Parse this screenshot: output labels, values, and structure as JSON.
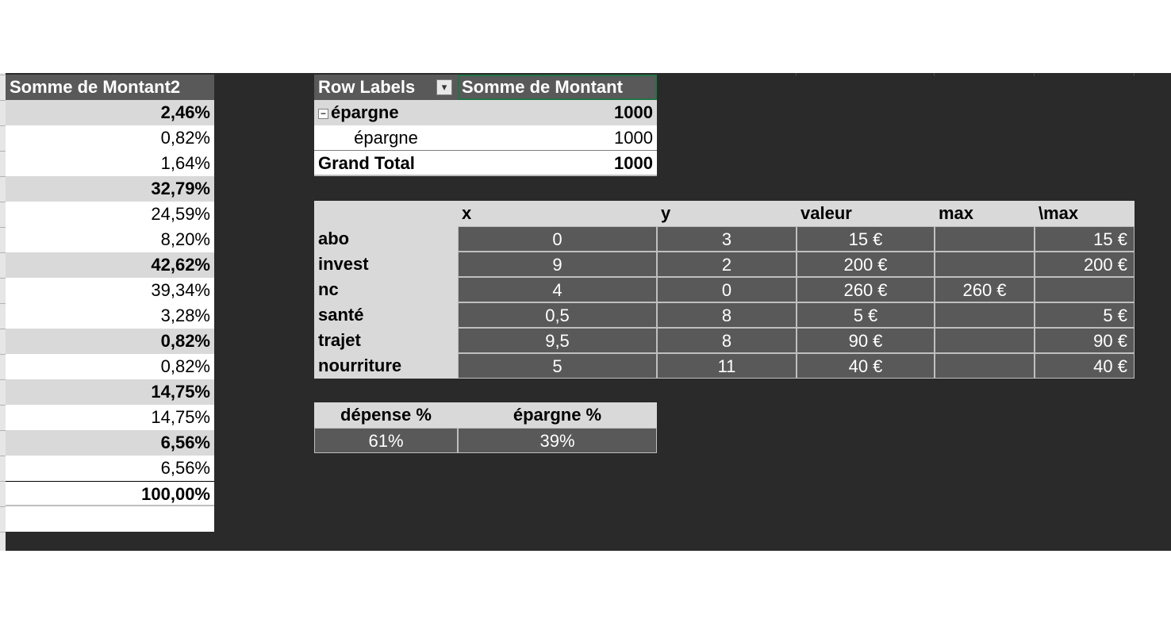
{
  "left_pivot": {
    "header": "Somme de Montant2",
    "rows": [
      {
        "value": "2,46%",
        "bold": true
      },
      {
        "value": "0,82%",
        "bold": false
      },
      {
        "value": "1,64%",
        "bold": false
      },
      {
        "value": "32,79%",
        "bold": true
      },
      {
        "value": "24,59%",
        "bold": false
      },
      {
        "value": "8,20%",
        "bold": false
      },
      {
        "value": "42,62%",
        "bold": true
      },
      {
        "value": "39,34%",
        "bold": false
      },
      {
        "value": "3,28%",
        "bold": false
      },
      {
        "value": "0,82%",
        "bold": true
      },
      {
        "value": "0,82%",
        "bold": false
      },
      {
        "value": "14,75%",
        "bold": true
      },
      {
        "value": "14,75%",
        "bold": false
      },
      {
        "value": "6,56%",
        "bold": true
      },
      {
        "value": "6,56%",
        "bold": false
      }
    ],
    "total": "100,00%"
  },
  "savings_pivot": {
    "col1_header": "Row Labels",
    "col2_header": "Somme de Montant",
    "filter_icon": "filter-dropdown-icon",
    "group_label": "épargne",
    "group_value": "1000",
    "collapse_icon": "minus-box-icon",
    "collapse_glyph": "−",
    "child_label": "épargne",
    "child_value": "1000",
    "total_label": "Grand Total",
    "total_value": "1000"
  },
  "category_table": {
    "headers": [
      "x",
      "y",
      "valeur",
      "max",
      "\\max"
    ],
    "rows": [
      {
        "label": "abo",
        "x": "0",
        "y": "3",
        "valeur": "15 €",
        "max": "",
        "nomax": "15 €"
      },
      {
        "label": "invest",
        "x": "9",
        "y": "2",
        "valeur": "200 €",
        "max": "",
        "nomax": "200 €"
      },
      {
        "label": "nc",
        "x": "4",
        "y": "0",
        "valeur": "260 €",
        "max": "260 €",
        "nomax": ""
      },
      {
        "label": "santé",
        "x": "0,5",
        "y": "8",
        "valeur": "5 €",
        "max": "",
        "nomax": "5 €"
      },
      {
        "label": "trajet",
        "x": "9,5",
        "y": "8",
        "valeur": "90 €",
        "max": "",
        "nomax": "90 €"
      },
      {
        "label": "nourriture",
        "x": "5",
        "y": "11",
        "valeur": "40 €",
        "max": "",
        "nomax": "40 €"
      }
    ]
  },
  "ratio_table": {
    "headers": [
      "dépense %",
      "épargne %"
    ],
    "values": [
      "61%",
      "39%"
    ]
  },
  "colors": {
    "sheet_background": "#2b2a2a",
    "pivot_header": "#595959",
    "band_gray": "#d9d9d9",
    "selection_border": "#217346"
  }
}
